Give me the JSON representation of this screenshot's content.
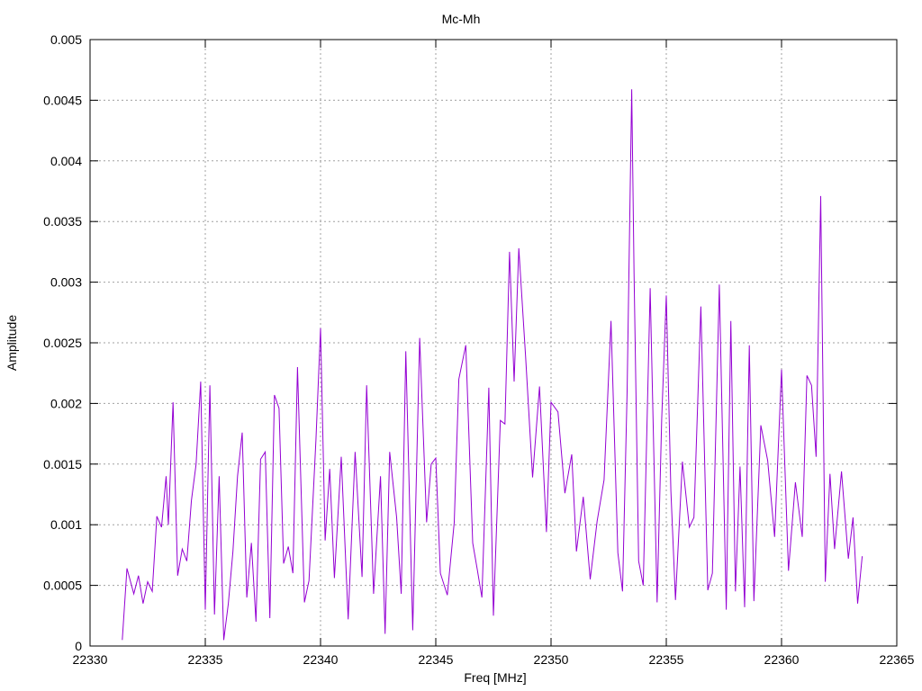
{
  "chart_data": {
    "type": "line",
    "title": "Mc-Mh",
    "xlabel": "Freq [MHz]",
    "ylabel": "Amplitude",
    "xlim": [
      22330,
      22365
    ],
    "ylim": [
      0,
      0.005
    ],
    "xticks": [
      "22330",
      "22335",
      "22340",
      "22345",
      "22350",
      "22355",
      "22360",
      "22365"
    ],
    "yticks": [
      "0",
      "0.0005",
      "0.001",
      "0.0015",
      "0.002",
      "0.0025",
      "0.003",
      "0.0035",
      "0.004",
      "0.0045",
      "0.005"
    ],
    "grid": true,
    "legend": "none",
    "series": [
      {
        "color": "#9400d3",
        "x": [
          22331.4,
          22331.6,
          22331.9,
          22332.1,
          22332.3,
          22332.5,
          22332.7,
          22332.9,
          22333.1,
          22333.3,
          22333.4,
          22333.6,
          22333.8,
          22334.0,
          22334.2,
          22334.4,
          22334.6,
          22334.8,
          22335.0,
          22335.2,
          22335.4,
          22335.6,
          22335.8,
          22336.0,
          22336.2,
          22336.4,
          22336.6,
          22336.8,
          22337.0,
          22337.2,
          22337.4,
          22337.6,
          22337.8,
          22338.0,
          22338.2,
          22338.4,
          22338.6,
          22338.8,
          22339.0,
          22339.3,
          22339.5,
          22339.8,
          22340.0,
          22340.2,
          22340.4,
          22340.6,
          22340.9,
          22341.2,
          22341.5,
          22341.8,
          22342.0,
          22342.3,
          22342.6,
          22342.8,
          22343.0,
          22343.3,
          22343.5,
          22343.7,
          22344.0,
          22344.3,
          22344.6,
          22344.8,
          22345.0,
          22345.2,
          22345.5,
          22345.8,
          22346.0,
          22346.3,
          22346.6,
          22346.8,
          22347.0,
          22347.3,
          22347.5,
          22347.8,
          22348.0,
          22348.2,
          22348.4,
          22348.6,
          22348.9,
          22349.2,
          22349.5,
          22349.8,
          22350.0,
          22350.3,
          22350.6,
          22350.9,
          22351.1,
          22351.4,
          22351.7,
          22352.0,
          22352.3,
          22352.6,
          22352.9,
          22353.1,
          22353.3,
          22353.5,
          22353.6,
          22353.8,
          22354.0,
          22354.3,
          22354.6,
          22354.8,
          22355.0,
          22355.2,
          22355.4,
          22355.7,
          22356.0,
          22356.2,
          22356.5,
          22356.8,
          22357.0,
          22357.3,
          22357.6,
          22357.8,
          22358.0,
          22358.2,
          22358.4,
          22358.6,
          22358.8,
          22359.1,
          22359.4,
          22359.7,
          22360.0,
          22360.3,
          22360.6,
          22360.9,
          22361.1,
          22361.3,
          22361.5,
          22361.7,
          22361.9,
          22362.1,
          22362.3,
          22362.6,
          22362.9,
          22363.1,
          22363.3,
          22363.5
        ],
        "y": [
          5e-05,
          0.00064,
          0.00043,
          0.00058,
          0.00035,
          0.00053,
          0.00045,
          0.00107,
          0.00098,
          0.0014,
          0.001,
          0.00201,
          0.00058,
          0.0008,
          0.0007,
          0.0012,
          0.0015,
          0.00218,
          0.0003,
          0.00215,
          0.00026,
          0.0014,
          5e-05,
          0.00035,
          0.00078,
          0.0014,
          0.00176,
          0.0004,
          0.00085,
          0.0002,
          0.00154,
          0.0016,
          0.00023,
          0.00207,
          0.00196,
          0.00068,
          0.00082,
          0.0006,
          0.0023,
          0.00036,
          0.00054,
          0.0017,
          0.00262,
          0.00087,
          0.00146,
          0.00056,
          0.00156,
          0.00022,
          0.0016,
          0.00057,
          0.00215,
          0.00043,
          0.0014,
          0.0001,
          0.0016,
          0.00106,
          0.00043,
          0.00243,
          0.00013,
          0.00254,
          0.00102,
          0.0015,
          0.00155,
          0.0006,
          0.00042,
          0.00102,
          0.0022,
          0.00248,
          0.00085,
          0.00063,
          0.0004,
          0.00213,
          0.00025,
          0.00186,
          0.00183,
          0.00325,
          0.00218,
          0.00328,
          0.00238,
          0.00139,
          0.00214,
          0.00094,
          0.00201,
          0.00193,
          0.00126,
          0.00158,
          0.00078,
          0.00123,
          0.00055,
          0.00103,
          0.00137,
          0.00268,
          0.00077,
          0.00045,
          0.0021,
          0.00459,
          0.00307,
          0.0007,
          0.0005,
          0.00295,
          0.00036,
          0.00187,
          0.00289,
          0.00128,
          0.00038,
          0.00152,
          0.00098,
          0.00106,
          0.0028,
          0.00046,
          0.0006,
          0.00298,
          0.0003,
          0.00268,
          0.00045,
          0.00148,
          0.00032,
          0.00248,
          0.00037,
          0.00182,
          0.00153,
          0.0009,
          0.00228,
          0.00062,
          0.00135,
          0.0009,
          0.00223,
          0.00215,
          0.00156,
          0.00371,
          0.00053,
          0.00142,
          0.0008,
          0.00144,
          0.00072,
          0.00106,
          0.00035,
          0.00074
        ]
      }
    ]
  }
}
